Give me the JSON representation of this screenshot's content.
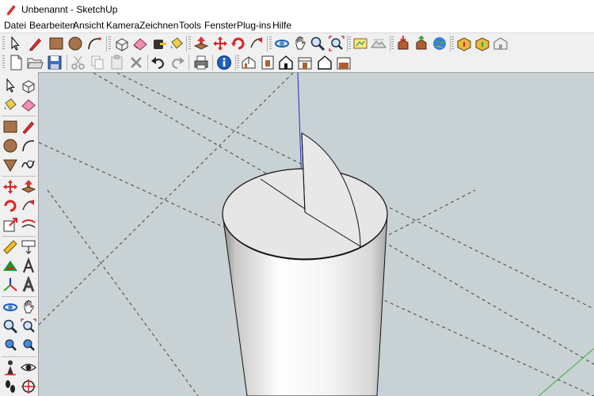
{
  "window": {
    "title": "Unbenannt - SketchUp",
    "app_icon": "sketchup-pencil-icon"
  },
  "menu": {
    "items": [
      "Datei",
      "Bearbeiten",
      "Ansicht",
      "Kamera",
      "Zeichnen",
      "Tools",
      "Fenster",
      "Plug-ins",
      "Hilfe"
    ]
  },
  "toolbar_top": {
    "tools": [
      "select",
      "pencil",
      "rectangle",
      "circle",
      "arc",
      "make-component",
      "eraser",
      "tape-measure",
      "paint-bucket",
      "push-pull",
      "move",
      "rotate",
      "follow-me",
      "orbit",
      "pan",
      "zoom",
      "zoom-extents",
      "add-location",
      "toggle-terrain",
      "get-models",
      "share-model",
      "3d-warehouse",
      "components-get",
      "components-share",
      "photo-textures"
    ]
  },
  "toolbar_std": {
    "tools": [
      "new",
      "open",
      "save",
      "cut",
      "copy",
      "paste",
      "erase",
      "undo",
      "redo",
      "print",
      "model-info",
      "iso-view",
      "top-view",
      "front-view",
      "right-view",
      "back-view",
      "left-view"
    ]
  },
  "left_toolbar": {
    "tools": [
      "select",
      "make-component",
      "paint-bucket",
      "eraser",
      "rectangle",
      "line",
      "circle",
      "arc",
      "polygon",
      "freehand",
      "move",
      "push-pull",
      "rotate",
      "follow-me",
      "scale",
      "offset",
      "tape-measure",
      "dimension",
      "protractor",
      "text",
      "axes",
      "3d-text",
      "orbit",
      "pan",
      "zoom",
      "zoom-window",
      "previous",
      "zoom-extents",
      "position-camera",
      "look-around",
      "walk",
      "section-plane"
    ]
  },
  "viewport": {
    "background_color": "#c8d1d3",
    "axis_colors": {
      "blue": "#1e2dd6",
      "green": "#2eb82e",
      "red": "#d03030"
    }
  },
  "colors": {
    "chrome": "#f0f0f0",
    "toolbar_border": "#a0a0a0"
  }
}
